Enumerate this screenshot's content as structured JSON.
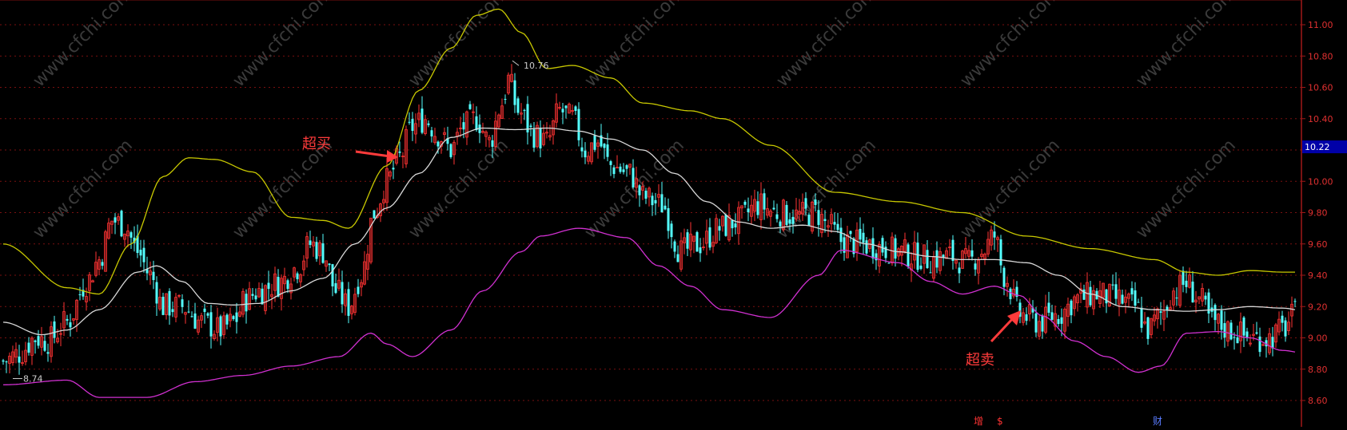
{
  "chart_data": {
    "type": "candlestick",
    "title": "",
    "indicator": "Bollinger Bands",
    "ylim": [
      8.5,
      11.2
    ],
    "y_ticks": [
      "11.00",
      "10.80",
      "10.60",
      "10.40",
      "10.20",
      "10.00",
      "9.80",
      "9.60",
      "9.40",
      "9.20",
      "9.00",
      "8.80",
      "8.60"
    ],
    "current_price": "10.22",
    "high_label": "10.76",
    "low_label": "8.74",
    "annotations": [
      {
        "text": "超买",
        "near_price": 10.24
      },
      {
        "text": "超卖",
        "near_price": 9.15
      }
    ],
    "bottom_markers": [
      "增",
      "$",
      "财"
    ],
    "watermark": "www.cfchi.com",
    "colors": {
      "background": "#000000",
      "up": "#ff3333",
      "down": "#54ffff",
      "upper_band": "#c8c800",
      "middle_band": "#d8d8d8",
      "lower_band": "#d030d0",
      "grid": "#7a1010",
      "axis": "#a01818",
      "tick_text": "#e03030",
      "price_tag": "#0000a8",
      "annotation": "#ff3b3b"
    },
    "mid_anchors": [
      [
        0,
        9.1
      ],
      [
        12,
        9.02
      ],
      [
        20,
        9.05
      ],
      [
        30,
        9.18
      ],
      [
        42,
        9.42
      ],
      [
        48,
        9.46
      ],
      [
        56,
        9.36
      ],
      [
        64,
        9.22
      ],
      [
        72,
        9.21
      ],
      [
        80,
        9.22
      ],
      [
        90,
        9.3
      ],
      [
        100,
        9.38
      ],
      [
        110,
        9.6
      ],
      [
        120,
        9.83
      ],
      [
        130,
        10.05
      ],
      [
        140,
        10.28
      ],
      [
        150,
        10.34
      ],
      [
        160,
        10.33
      ],
      [
        170,
        10.34
      ],
      [
        180,
        10.32
      ],
      [
        190,
        10.27
      ],
      [
        200,
        10.2
      ],
      [
        210,
        10.05
      ],
      [
        220,
        9.87
      ],
      [
        230,
        9.74
      ],
      [
        240,
        9.7
      ],
      [
        250,
        9.72
      ],
      [
        260,
        9.68
      ],
      [
        270,
        9.6
      ],
      [
        280,
        9.55
      ],
      [
        290,
        9.52
      ],
      [
        300,
        9.5
      ],
      [
        310,
        9.5
      ],
      [
        320,
        9.48
      ],
      [
        330,
        9.4
      ],
      [
        340,
        9.28
      ],
      [
        350,
        9.2
      ],
      [
        360,
        9.18
      ],
      [
        370,
        9.17
      ],
      [
        380,
        9.18
      ],
      [
        390,
        9.2
      ],
      [
        400,
        9.19
      ],
      [
        410,
        9.16
      ]
    ],
    "upper_anchors": [
      [
        0,
        9.6
      ],
      [
        20,
        9.32
      ],
      [
        30,
        9.28
      ],
      [
        40,
        9.6
      ],
      [
        50,
        10.03
      ],
      [
        58,
        10.15
      ],
      [
        66,
        10.14
      ],
      [
        78,
        10.06
      ],
      [
        90,
        9.77
      ],
      [
        100,
        9.75
      ],
      [
        108,
        9.7
      ],
      [
        120,
        10.1
      ],
      [
        130,
        10.58
      ],
      [
        140,
        10.85
      ],
      [
        148,
        11.06
      ],
      [
        155,
        11.1
      ],
      [
        162,
        10.95
      ],
      [
        170,
        10.72
      ],
      [
        178,
        10.74
      ],
      [
        190,
        10.66
      ],
      [
        200,
        10.5
      ],
      [
        215,
        10.45
      ],
      [
        225,
        10.4
      ],
      [
        240,
        10.23
      ],
      [
        260,
        9.93
      ],
      [
        280,
        9.87
      ],
      [
        300,
        9.8
      ],
      [
        320,
        9.65
      ],
      [
        340,
        9.57
      ],
      [
        360,
        9.5
      ],
      [
        370,
        9.42
      ],
      [
        380,
        9.4
      ],
      [
        390,
        9.43
      ],
      [
        400,
        9.42
      ],
      [
        410,
        9.42
      ]
    ],
    "lower_anchors": [
      [
        0,
        8.7
      ],
      [
        20,
        8.73
      ],
      [
        30,
        8.62
      ],
      [
        45,
        8.62
      ],
      [
        60,
        8.72
      ],
      [
        75,
        8.76
      ],
      [
        90,
        8.82
      ],
      [
        105,
        8.88
      ],
      [
        115,
        9.03
      ],
      [
        120,
        8.96
      ],
      [
        128,
        8.88
      ],
      [
        140,
        9.05
      ],
      [
        150,
        9.3
      ],
      [
        162,
        9.55
      ],
      [
        168,
        9.65
      ],
      [
        180,
        9.7
      ],
      [
        195,
        9.64
      ],
      [
        205,
        9.46
      ],
      [
        215,
        9.33
      ],
      [
        225,
        9.18
      ],
      [
        240,
        9.13
      ],
      [
        255,
        9.4
      ],
      [
        262,
        9.56
      ],
      [
        280,
        9.48
      ],
      [
        290,
        9.36
      ],
      [
        300,
        9.28
      ],
      [
        310,
        9.33
      ],
      [
        318,
        9.27
      ],
      [
        325,
        9.14
      ],
      [
        335,
        8.98
      ],
      [
        345,
        8.88
      ],
      [
        355,
        8.78
      ],
      [
        362,
        8.82
      ],
      [
        370,
        9.03
      ],
      [
        380,
        9.04
      ],
      [
        390,
        9.0
      ],
      [
        400,
        8.92
      ],
      [
        410,
        8.89
      ]
    ],
    "close_anchors": [
      [
        0,
        8.85
      ],
      [
        5,
        8.9
      ],
      [
        10,
        9.0
      ],
      [
        14,
        8.98
      ],
      [
        20,
        9.1
      ],
      [
        26,
        9.35
      ],
      [
        30,
        9.5
      ],
      [
        34,
        9.75
      ],
      [
        38,
        9.72
      ],
      [
        42,
        9.55
      ],
      [
        46,
        9.4
      ],
      [
        50,
        9.2
      ],
      [
        56,
        9.2
      ],
      [
        62,
        9.1
      ],
      [
        68,
        9.05
      ],
      [
        72,
        9.1
      ],
      [
        76,
        9.25
      ],
      [
        80,
        9.3
      ],
      [
        86,
        9.35
      ],
      [
        92,
        9.45
      ],
      [
        96,
        9.6
      ],
      [
        100,
        9.55
      ],
      [
        104,
        9.3
      ],
      [
        108,
        9.2
      ],
      [
        112,
        9.4
      ],
      [
        116,
        9.8
      ],
      [
        120,
        10.0
      ],
      [
        124,
        10.15
      ],
      [
        128,
        10.35
      ],
      [
        132,
        10.4
      ],
      [
        136,
        10.3
      ],
      [
        140,
        10.2
      ],
      [
        144,
        10.35
      ],
      [
        148,
        10.4
      ],
      [
        152,
        10.25
      ],
      [
        156,
        10.5
      ],
      [
        158,
        10.65
      ],
      [
        161,
        10.45
      ],
      [
        166,
        10.3
      ],
      [
        170,
        10.25
      ],
      [
        174,
        10.45
      ],
      [
        178,
        10.4
      ],
      [
        182,
        10.2
      ],
      [
        186,
        10.25
      ],
      [
        190,
        10.1
      ],
      [
        196,
        10.05
      ],
      [
        200,
        9.9
      ],
      [
        206,
        9.85
      ],
      [
        212,
        9.55
      ],
      [
        218,
        9.6
      ],
      [
        224,
        9.7
      ],
      [
        230,
        9.75
      ],
      [
        236,
        9.85
      ],
      [
        242,
        9.8
      ],
      [
        248,
        9.78
      ],
      [
        254,
        9.8
      ],
      [
        258,
        9.72
      ],
      [
        262,
        9.62
      ],
      [
        268,
        9.6
      ],
      [
        274,
        9.58
      ],
      [
        280,
        9.55
      ],
      [
        286,
        9.52
      ],
      [
        290,
        9.5
      ],
      [
        296,
        9.52
      ],
      [
        302,
        9.48
      ],
      [
        306,
        9.55
      ],
      [
        310,
        9.65
      ],
      [
        313,
        9.4
      ],
      [
        318,
        9.15
      ],
      [
        324,
        9.1
      ],
      [
        330,
        9.15
      ],
      [
        336,
        9.25
      ],
      [
        342,
        9.28
      ],
      [
        348,
        9.25
      ],
      [
        354,
        9.2
      ],
      [
        358,
        9.05
      ],
      [
        362,
        9.15
      ],
      [
        366,
        9.3
      ],
      [
        370,
        9.35
      ],
      [
        374,
        9.25
      ],
      [
        378,
        9.1
      ],
      [
        384,
        9.05
      ],
      [
        390,
        9.0
      ],
      [
        396,
        9.0
      ],
      [
        400,
        9.05
      ],
      [
        404,
        9.15
      ]
    ],
    "candles_total": 405
  }
}
